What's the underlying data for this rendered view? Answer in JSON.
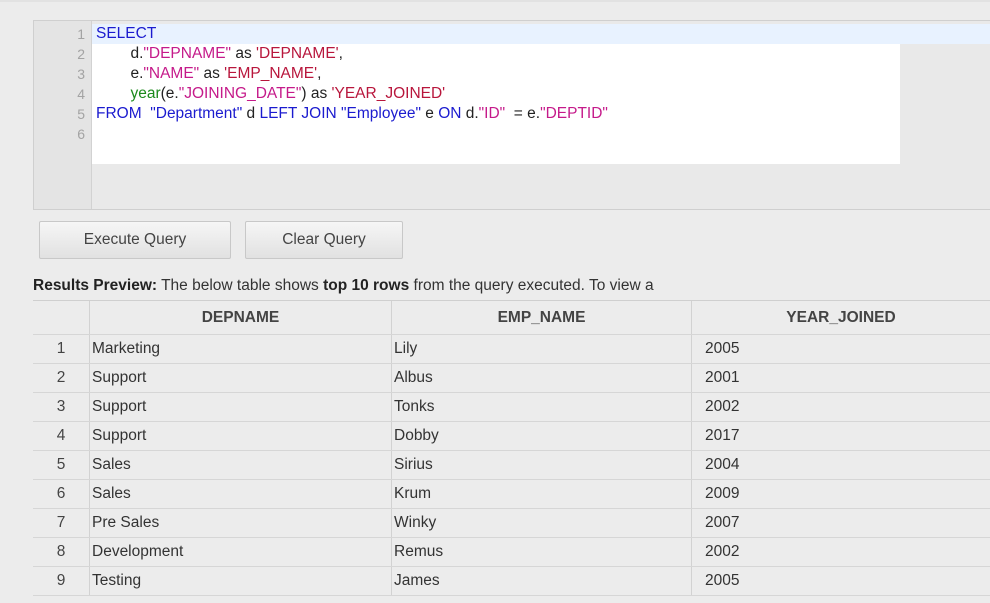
{
  "editor": {
    "lines": [
      {
        "num": "1",
        "parts": [
          {
            "t": "SELECT",
            "c": "kw"
          }
        ]
      },
      {
        "num": "2",
        "parts": [
          {
            "t": "        d.",
            "c": "plain"
          },
          {
            "t": "\"DEPNAME\"",
            "c": "str"
          },
          {
            "t": " as ",
            "c": "plain"
          },
          {
            "t": "'DEPNAME'",
            "c": "qstr"
          },
          {
            "t": ",",
            "c": "plain"
          }
        ]
      },
      {
        "num": "3",
        "parts": [
          {
            "t": "        e.",
            "c": "plain"
          },
          {
            "t": "\"NAME\"",
            "c": "str"
          },
          {
            "t": " as ",
            "c": "plain"
          },
          {
            "t": "'EMP_NAME'",
            "c": "qstr"
          },
          {
            "t": ",",
            "c": "plain"
          }
        ]
      },
      {
        "num": "4",
        "parts": [
          {
            "t": "        ",
            "c": "plain"
          },
          {
            "t": "year",
            "c": "fn"
          },
          {
            "t": "(e.",
            "c": "plain"
          },
          {
            "t": "\"JOINING_DATE\"",
            "c": "str"
          },
          {
            "t": ") as ",
            "c": "plain"
          },
          {
            "t": "'YEAR_JOINED'",
            "c": "qstr"
          }
        ]
      },
      {
        "num": "5",
        "parts": [
          {
            "t": "FROM ",
            "c": "kw"
          },
          {
            "t": " \"Department\"",
            "c": "kw"
          },
          {
            "t": " d ",
            "c": "plain"
          },
          {
            "t": "LEFT JOIN ",
            "c": "kw"
          },
          {
            "t": "\"Employee\"",
            "c": "kw"
          },
          {
            "t": " e ",
            "c": "plain"
          },
          {
            "t": "ON",
            "c": "kw"
          },
          {
            "t": " d.",
            "c": "plain"
          },
          {
            "t": "\"ID\"",
            "c": "str"
          },
          {
            "t": "  = e.",
            "c": "plain"
          },
          {
            "t": "\"DEPTID\"",
            "c": "str"
          }
        ]
      },
      {
        "num": "6",
        "parts": []
      }
    ]
  },
  "toolbar": {
    "execute_label": "Execute Query",
    "clear_label": "Clear Query"
  },
  "results": {
    "caption_bold_1": "Results Preview:",
    "caption_text_1": " The below table shows ",
    "caption_bold_2": "top 10 rows",
    "caption_text_2": " from the query executed. To view a",
    "columns": [
      "DEPNAME",
      "EMP_NAME",
      "YEAR_JOINED"
    ],
    "rows": [
      {
        "n": "1",
        "dep": "Marketing",
        "emp": "Lily",
        "year": "2005"
      },
      {
        "n": "2",
        "dep": "Support",
        "emp": "Albus",
        "year": "2001"
      },
      {
        "n": "3",
        "dep": "Support",
        "emp": "Tonks",
        "year": "2002"
      },
      {
        "n": "4",
        "dep": "Support",
        "emp": "Dobby",
        "year": "2017"
      },
      {
        "n": "5",
        "dep": "Sales",
        "emp": "Sirius",
        "year": "2004"
      },
      {
        "n": "6",
        "dep": "Sales",
        "emp": "Krum",
        "year": "2009"
      },
      {
        "n": "7",
        "dep": "Pre Sales",
        "emp": "Winky",
        "year": "2007"
      },
      {
        "n": "8",
        "dep": "Development",
        "emp": "Remus",
        "year": "2002"
      },
      {
        "n": "9",
        "dep": "Testing",
        "emp": "James",
        "year": "2005"
      }
    ]
  }
}
